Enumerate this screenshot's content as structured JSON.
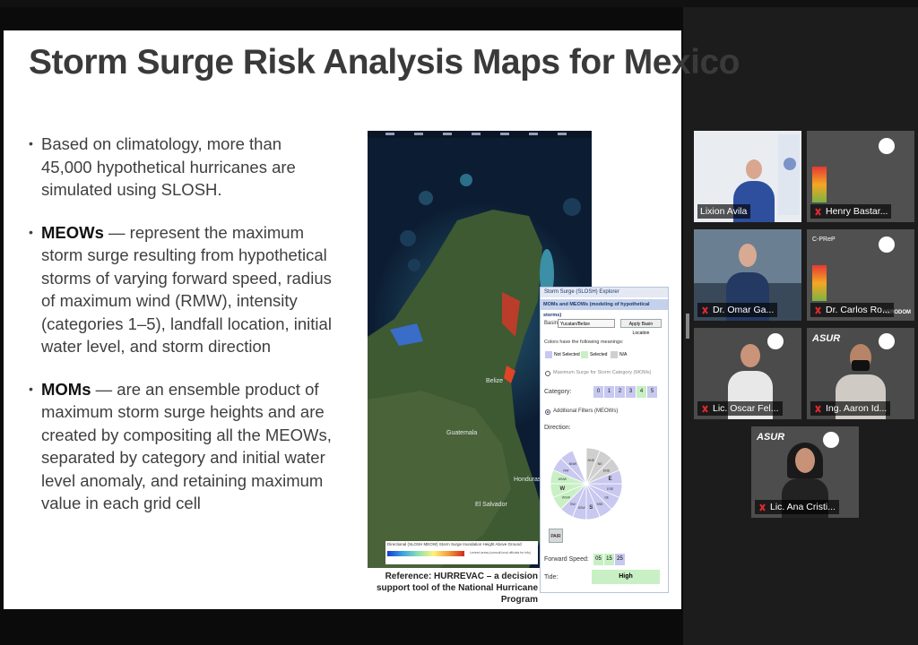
{
  "slide": {
    "title": "Storm Surge Risk Analysis Maps for Mexico",
    "bullets": [
      {
        "bold": "",
        "text": "Based on climatology, more than 45,000 hypothetical hurricanes are simulated using SLOSH."
      },
      {
        "bold": "MEOWs",
        "text": " — represent the maximum storm surge resulting from hypothetical storms of varying forward speed, radius of maximum wind (RMW), intensity (categories 1–5), landfall location, initial water level, and storm direction"
      },
      {
        "bold": "MOMs",
        "text": " — are an ensemble product of maximum storm surge heights and are created by compositing all the MEOWs, separated by category and initial water level anomaly, and retaining maximum value in each grid cell"
      }
    ],
    "map_labels": {
      "belize": "Belize",
      "guatemala": "Guatemala",
      "honduras": "Honduras",
      "el_salvador": "El Salvador"
    },
    "legend": {
      "title": "Directional (SLOSH MEOW) Storm Surge Inundation Height Above Ground",
      "note": "Leveed areas (consult local officials for info)"
    },
    "reference": "Reference: HURREVAC – a decision support tool of the National Hurricane Program"
  },
  "explorer": {
    "title": "Storm Surge (SLOSH) Explorer",
    "tab": "MOMs and MEOWs (modeling of hypothetical storms)",
    "basin_label": "Basin:",
    "basin_value": "Yucatan/Belize",
    "apply_button": "Apply Basin Location",
    "colors_meaning": "Colors have the following meanings:",
    "legend": {
      "not_selected": "Not Selected",
      "selected": "Selected",
      "na": "N/A"
    },
    "mom_option": "Maximum Surge for Storm Category (MOMs)",
    "category_label": "Category:",
    "categories": [
      "0",
      "1",
      "2",
      "3",
      "4",
      "5"
    ],
    "additional_filters": "Additional Filters (MEOWs)",
    "direction_label": "Direction:",
    "directions": [
      "NNW",
      "NW",
      "WNW",
      "W",
      "WSW",
      "SW",
      "SSW",
      "S",
      "SSE",
      "SE",
      "ESE",
      "E",
      "ENE",
      "NE",
      "NNE"
    ],
    "pair_label": "PAIR",
    "forward_speed_label": "Forward Speed:",
    "speeds": [
      "05",
      "15",
      "25"
    ],
    "tide_label": "Tide:",
    "tide_value": "High",
    "colors": {
      "not_selected": "#c8c8f0",
      "selected": "#c8f0c4",
      "na": "#cfcfcf"
    }
  },
  "participants": [
    {
      "name": "Lixion Avila",
      "muted": false,
      "active": true
    },
    {
      "name": "Henry Bastar...",
      "muted": true,
      "active": false
    },
    {
      "name": "Dr. Omar Ga...",
      "muted": true,
      "active": false
    },
    {
      "name": "Dr. Carlos Ro...",
      "muted": true,
      "active": false
    },
    {
      "name": "Lic. Oscar Fel...",
      "muted": true,
      "active": false
    },
    {
      "name": "Ing. Aaron Id...",
      "muted": true,
      "active": false
    },
    {
      "name": "Lic. Ana Cristi...",
      "muted": true,
      "active": false
    }
  ],
  "logos": {
    "asur": "ASUR",
    "aerodom": "AERODOM",
    "cprep": "C-PReP"
  },
  "accent": "#b5e12e",
  "muted_color": "#e0292f"
}
